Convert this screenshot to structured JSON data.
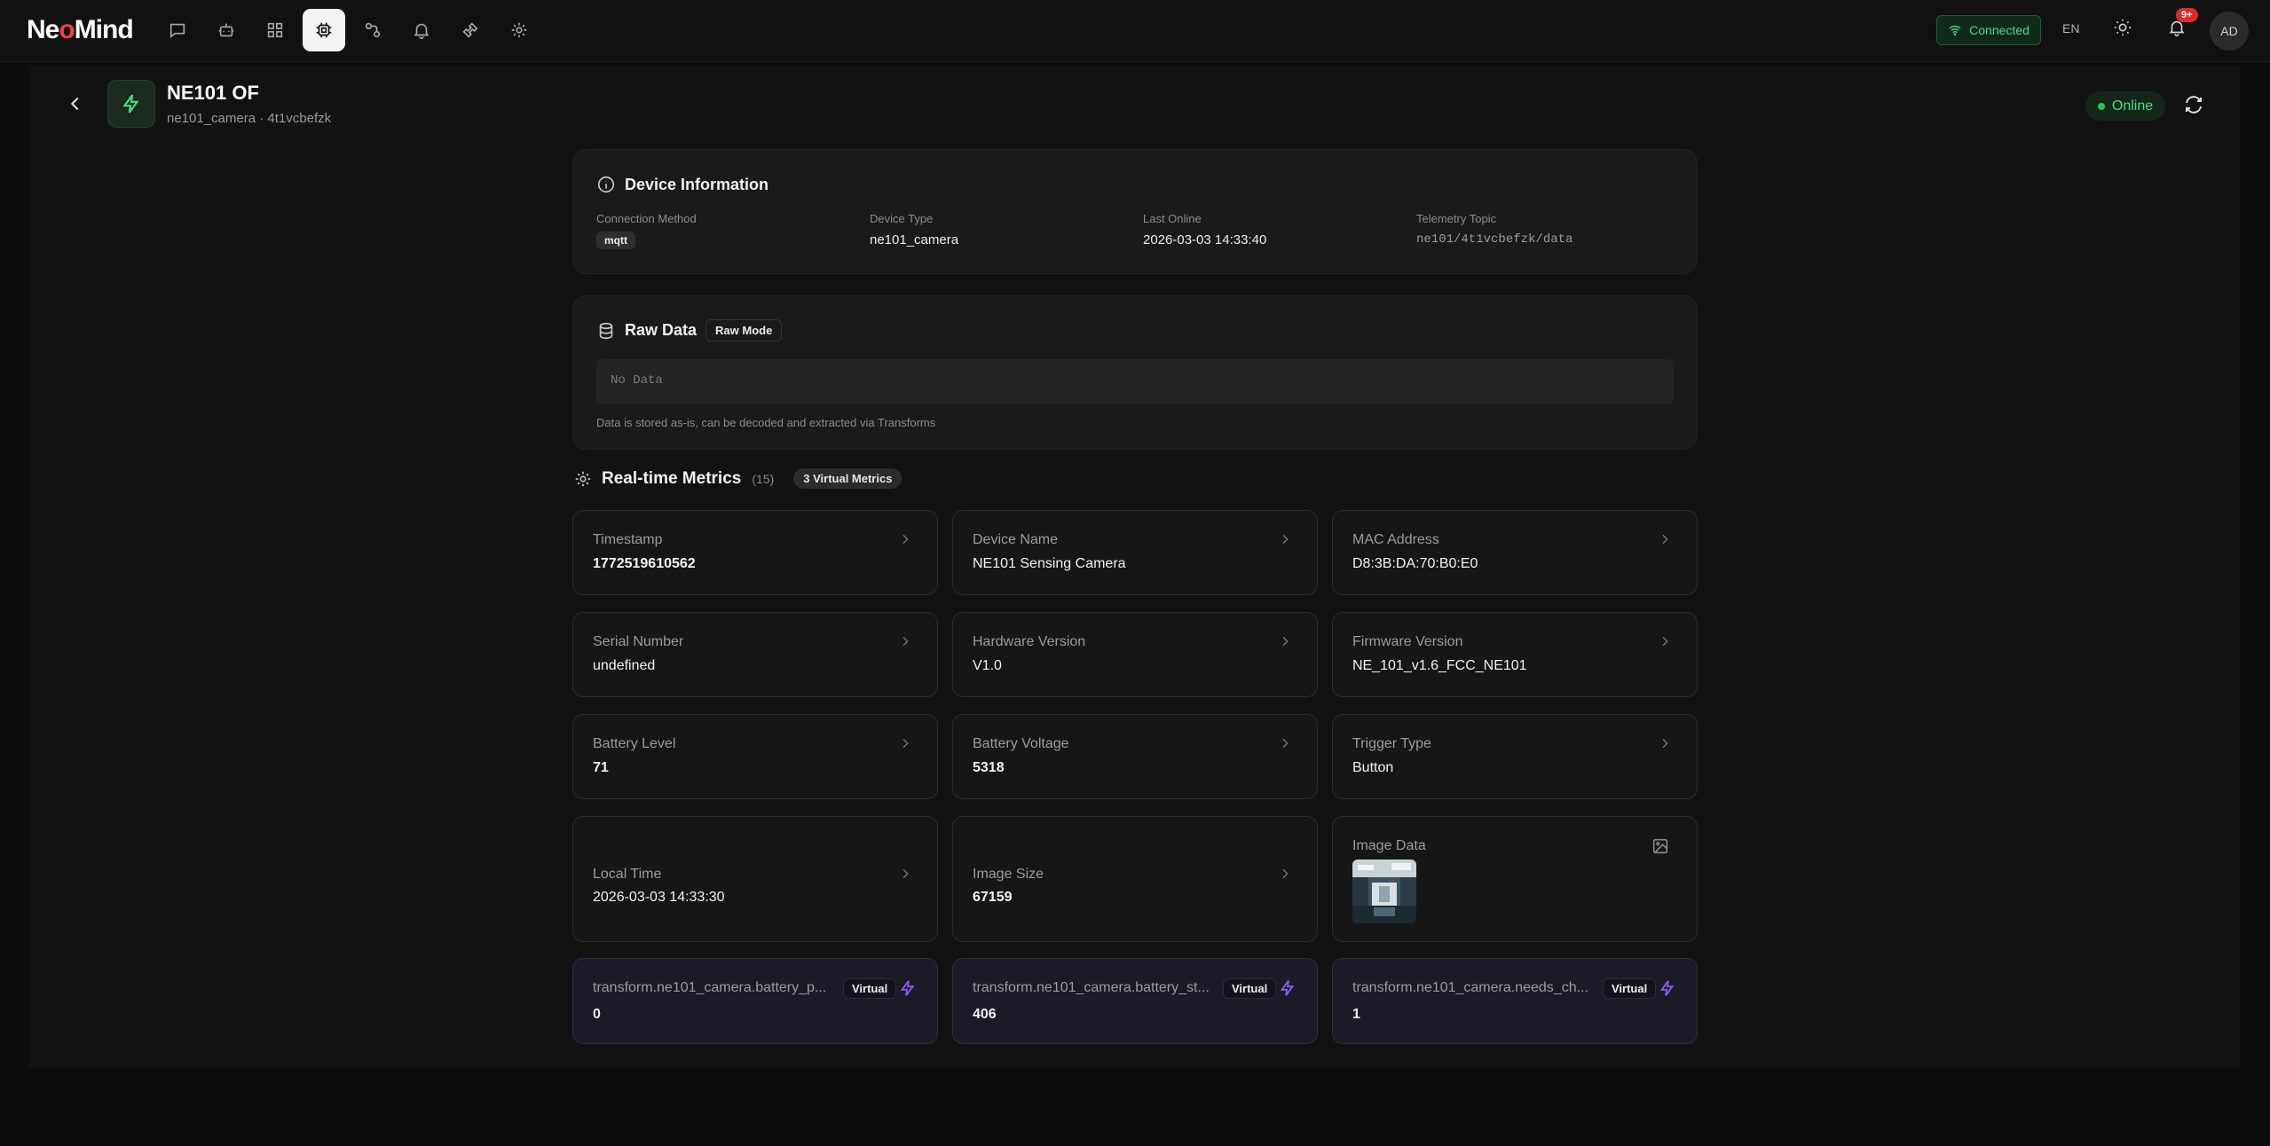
{
  "app": {
    "logo_prefix": "Ne",
    "logo_mid": "o",
    "logo_suffix": "Mind"
  },
  "nav": {
    "items": [
      {
        "name": "chat-icon",
        "active": false
      },
      {
        "name": "robot-icon",
        "active": false
      },
      {
        "name": "dashboard-icon",
        "active": false
      },
      {
        "name": "chip-icon",
        "active": true
      },
      {
        "name": "workflow-icon",
        "active": false
      },
      {
        "name": "bell-icon",
        "active": false
      },
      {
        "name": "plugin-icon",
        "active": false
      },
      {
        "name": "gear-icon",
        "active": false
      }
    ]
  },
  "header": {
    "connection": "Connected",
    "language": "EN",
    "notifications_badge": "9+",
    "avatar_initials": "AD"
  },
  "device": {
    "title": "NE101 OF",
    "subtitle": "ne101_camera · 4t1vcbefzk",
    "status": "Online",
    "accent_color": "#4ade80"
  },
  "device_info": {
    "title": "Device Information",
    "connection_method": {
      "label": "Connection Method",
      "value": "mqtt"
    },
    "device_type": {
      "label": "Device Type",
      "value": "ne101_camera"
    },
    "last_online": {
      "label": "Last Online",
      "value": "2026-03-03 14:33:40"
    },
    "telemetry_topic": {
      "label": "Telemetry Topic",
      "value": "ne101/4t1vcbefzk/data"
    }
  },
  "raw_data": {
    "title": "Raw Data",
    "mode": "Raw Mode",
    "content": "No Data",
    "note": "Data is stored as-is, can be decoded and extracted via Transforms"
  },
  "metrics": {
    "title": "Real-time Metrics",
    "count": "(15)",
    "virtual_badge": "3 Virtual Metrics",
    "cards": [
      {
        "label": "Timestamp",
        "value": "1772519610562"
      },
      {
        "label": "Device Name",
        "value": "NE101 Sensing Camera"
      },
      {
        "label": "MAC Address",
        "value": "D8:3B:DA:70:B0:E0"
      },
      {
        "label": "Serial Number",
        "value": "undefined"
      },
      {
        "label": "Hardware Version",
        "value": "V1.0"
      },
      {
        "label": "Firmware Version",
        "value": "NE_101_v1.6_FCC_NE101"
      },
      {
        "label": "Battery Level",
        "value": "71"
      },
      {
        "label": "Battery Voltage",
        "value": "5318"
      },
      {
        "label": "Trigger Type",
        "value": "Button"
      },
      {
        "label": "Local Time",
        "value": "2026-03-03 14:33:30"
      },
      {
        "label": "Image Size",
        "value": "67159"
      },
      {
        "label": "Image Data",
        "value": ""
      }
    ],
    "virtual_cards": [
      {
        "label": "transform.ne101_camera.battery_p...",
        "tag": "Virtual",
        "value": "0"
      },
      {
        "label": "transform.ne101_camera.battery_st...",
        "tag": "Virtual",
        "value": "406"
      },
      {
        "label": "transform.ne101_camera.needs_ch...",
        "tag": "Virtual",
        "value": "1"
      }
    ],
    "virtual_color": "#8b5cf6"
  }
}
